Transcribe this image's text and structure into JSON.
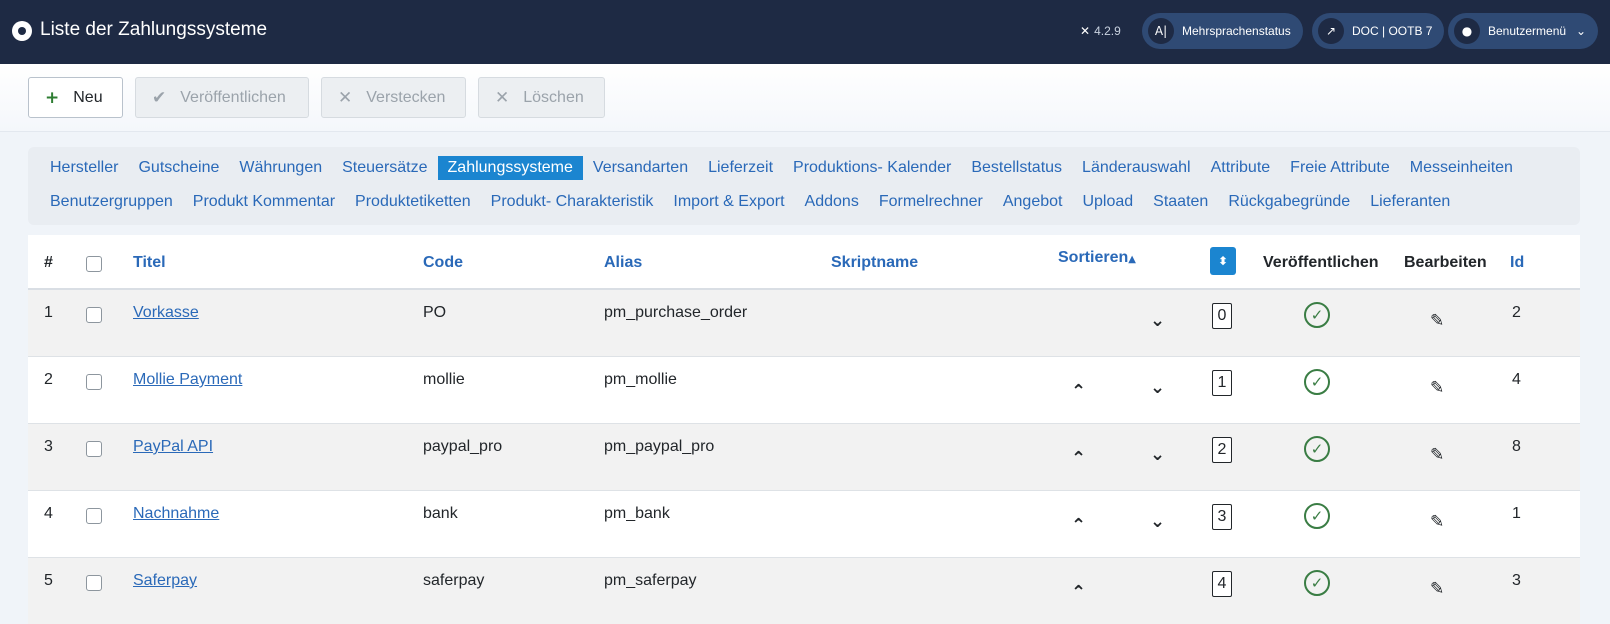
{
  "header": {
    "title": "Liste der Zahlungssysteme",
    "version": "4.2.9",
    "multilang_label": "Mehrsprachenstatus",
    "site_label": "DOC | OOTB 7",
    "user_menu_label": "Benutzermenü"
  },
  "toolbar": {
    "new_label": "Neu",
    "publish_label": "Veröffentlichen",
    "hide_label": "Verstecken",
    "delete_label": "Löschen"
  },
  "submenu": {
    "row1": [
      "Hersteller",
      "Gutscheine",
      "Währungen",
      "Steuersätze",
      "Zahlungssysteme",
      "Versandarten",
      "Lieferzeit",
      "Produktions- Kalender",
      "Bestellstatus",
      "Länderauswahl",
      "Attribute",
      "Freie Attribute",
      "Messeinheiten"
    ],
    "row2": [
      "Benutzergruppen",
      "Produkt Kommentar",
      "Produktetiketten",
      "Produkt- Charakteristik",
      "Import & Export",
      "Addons",
      "Formelrechner",
      "Angebot",
      "Upload",
      "Staaten",
      "Rückgabegründe",
      "Lieferanten"
    ],
    "active": "Zahlungssysteme"
  },
  "table": {
    "headers": {
      "num": "#",
      "title": "Titel",
      "code": "Code",
      "alias": "Alias",
      "script": "Skriptname",
      "sort": "Sortieren",
      "published": "Veröffentlichen",
      "edit": "Bearbeiten",
      "id": "Id"
    },
    "rows": [
      {
        "num": "1",
        "title": "Vorkasse",
        "code": "PO",
        "alias": "pm_purchase_order",
        "script": "",
        "order": "0",
        "id": "2"
      },
      {
        "num": "2",
        "title": "Mollie Payment",
        "code": "mollie",
        "alias": "pm_mollie",
        "script": "",
        "order": "1",
        "id": "4"
      },
      {
        "num": "3",
        "title": "PayPal API",
        "code": "paypal_pro",
        "alias": "pm_paypal_pro",
        "script": "",
        "order": "2",
        "id": "8"
      },
      {
        "num": "4",
        "title": "Nachnahme",
        "code": "bank",
        "alias": "pm_bank",
        "script": "",
        "order": "3",
        "id": "1"
      },
      {
        "num": "5",
        "title": "Saferpay",
        "code": "saferpay",
        "alias": "pm_saferpay",
        "script": "",
        "order": "4",
        "id": "3"
      }
    ]
  }
}
